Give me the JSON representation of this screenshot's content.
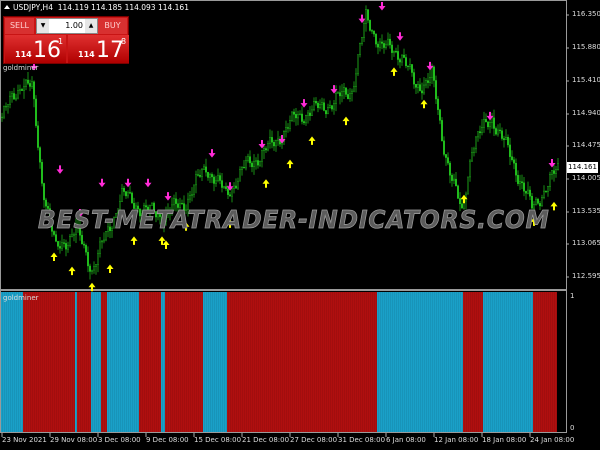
{
  "header": {
    "symbol": "USDJPY,H4",
    "ohlc": "114.119 114.185 114.093 114.161"
  },
  "trade_panel": {
    "sell_label": "SELL",
    "buy_label": "BUY",
    "lot": "1.00",
    "lot_down": "▼",
    "lot_up": "▲",
    "sell_quote": {
      "small": "114",
      "big": "16",
      "pip": "1"
    },
    "buy_quote": {
      "small": "114",
      "big": "17",
      "pip": "8"
    }
  },
  "main_indicator_label": "goldminer",
  "sub_indicator_label": "goldminer",
  "watermark": "BEST-METATRADER-INDICATORS.COM",
  "current_price": "114.161",
  "price_axis": [
    "116.350",
    "115.880",
    "115.410",
    "114.940",
    "114.475",
    "114.005",
    "113.535",
    "113.065",
    "112.595"
  ],
  "indicator_axis": [
    "1",
    "0"
  ],
  "time_axis": [
    "23 Nov 2021",
    "29 Nov 08:00",
    "3 Dec 08:00",
    "9 Dec 08:00",
    "15 Dec 08:00",
    "21 Dec 08:00",
    "27 Dec 08:00",
    "31 Dec 08:00",
    "6 Jan 08:00",
    "12 Jan 08:00",
    "18 Jan 08:00",
    "24 Jan 08:00"
  ],
  "colors": {
    "candle": "#22c81e",
    "sell_arrow": "#ff2bd6",
    "buy_arrow": "#ffff00",
    "ind_red": "#b00f0f",
    "ind_blue": "#1aa0c8"
  },
  "chart_data": {
    "type": "candlestick",
    "price_range": [
      112.5,
      116.45
    ],
    "bars": 279,
    "close_keypoints": [
      [
        0,
        114.9
      ],
      [
        10,
        115.4
      ],
      [
        15,
        115.3
      ],
      [
        20,
        114.0
      ],
      [
        27,
        113.0
      ],
      [
        37,
        113.3
      ],
      [
        45,
        112.75
      ],
      [
        52,
        113.2
      ],
      [
        60,
        113.8
      ],
      [
        70,
        113.6
      ],
      [
        80,
        113.5
      ],
      [
        92,
        113.7
      ],
      [
        102,
        114.2
      ],
      [
        112,
        113.8
      ],
      [
        122,
        114.2
      ],
      [
        135,
        114.5
      ],
      [
        147,
        114.9
      ],
      [
        165,
        115.1
      ],
      [
        175,
        115.3
      ],
      [
        182,
        116.3
      ],
      [
        190,
        115.9
      ],
      [
        200,
        115.8
      ],
      [
        207,
        115.3
      ],
      [
        215,
        115.5
      ],
      [
        220,
        114.6
      ],
      [
        230,
        113.5
      ],
      [
        235,
        114.5
      ],
      [
        245,
        114.9
      ],
      [
        255,
        114.3
      ],
      [
        265,
        113.6
      ],
      [
        272,
        113.9
      ],
      [
        278,
        114.16
      ]
    ],
    "sell_arrows": [
      [
        16,
        115.5
      ],
      [
        29,
        114.03
      ],
      [
        39,
        113.41
      ],
      [
        50,
        113.84
      ],
      [
        63,
        113.84
      ],
      [
        73,
        113.84
      ],
      [
        83,
        113.65
      ],
      [
        105,
        114.26
      ],
      [
        114,
        113.79
      ],
      [
        130,
        114.39
      ],
      [
        140,
        114.46
      ],
      [
        151,
        114.97
      ],
      [
        166,
        115.17
      ],
      [
        180,
        116.17
      ],
      [
        190,
        116.35
      ],
      [
        199,
        115.92
      ],
      [
        214,
        115.5
      ],
      [
        244,
        114.79
      ],
      [
        275,
        114.12
      ]
    ],
    "buy_arrows": [
      [
        26,
        113.04
      ],
      [
        35,
        112.84
      ],
      [
        45,
        112.61
      ],
      [
        54,
        112.87
      ],
      [
        66,
        113.27
      ],
      [
        80,
        113.27
      ],
      [
        82,
        113.21
      ],
      [
        92,
        113.47
      ],
      [
        114,
        113.51
      ],
      [
        132,
        114.08
      ],
      [
        144,
        114.36
      ],
      [
        155,
        114.69
      ],
      [
        172,
        114.97
      ],
      [
        196,
        115.67
      ],
      [
        211,
        115.21
      ],
      [
        231,
        113.86
      ],
      [
        266,
        113.54
      ],
      [
        276,
        113.76
      ]
    ],
    "indicator_segments": [
      [
        "blue",
        0,
        11
      ],
      [
        "red",
        11,
        37
      ],
      [
        "blue",
        37,
        38
      ],
      [
        "red",
        38,
        45
      ],
      [
        "blue",
        45,
        50
      ],
      [
        "red",
        50,
        53
      ],
      [
        "blue",
        53,
        69
      ],
      [
        "red",
        69,
        80
      ],
      [
        "blue",
        80,
        82
      ],
      [
        "red",
        82,
        101
      ],
      [
        "blue",
        101,
        113
      ],
      [
        "red",
        113,
        188
      ],
      [
        "blue",
        188,
        231
      ],
      [
        "red",
        231,
        241
      ],
      [
        "blue",
        241,
        266
      ],
      [
        "red",
        266,
        278
      ]
    ],
    "indicator_range": [
      0,
      1
    ]
  }
}
